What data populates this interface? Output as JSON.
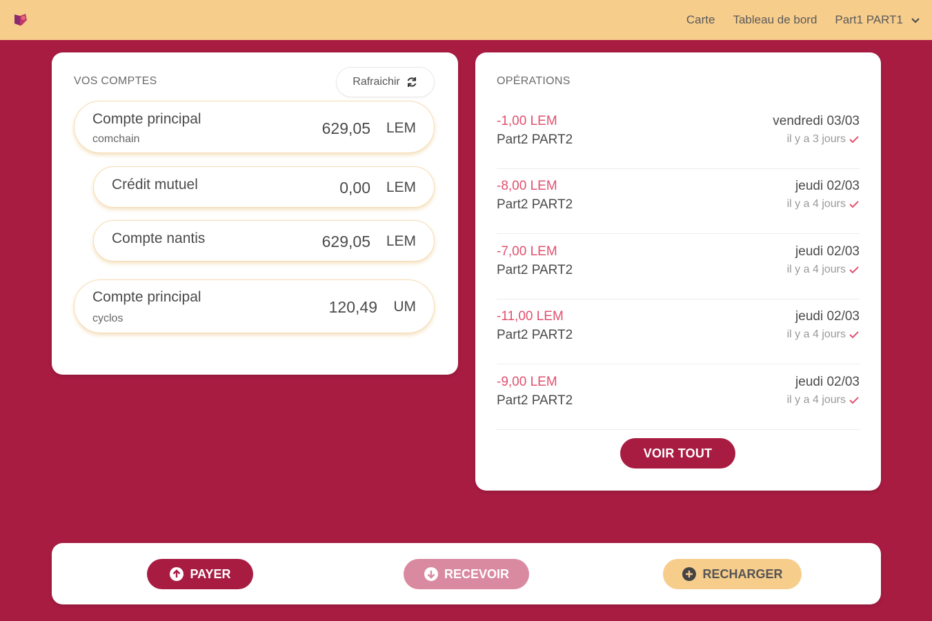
{
  "colors": {
    "background": "#a81c42",
    "topbar": "#f7cd8c",
    "negative_amount": "#e0506e",
    "pay_button": "#a81c42",
    "receive_button": "#d98aa0",
    "recharge_button": "#f7cd8c"
  },
  "topbar": {
    "logo_icon": "app-logo-icon",
    "nav": {
      "map": "Carte",
      "dashboard": "Tableau de bord",
      "user": "Part1 PART1"
    }
  },
  "accounts": {
    "title": "VOS COMPTES",
    "refresh_label": "Rafraichir",
    "items": [
      {
        "name": "Compte principal",
        "sub": "comchain",
        "amount": "629,05",
        "currency": "LEM"
      },
      {
        "name": "Crédit mutuel",
        "sub": "",
        "amount": "0,00",
        "currency": "LEM"
      },
      {
        "name": "Compte nantis",
        "sub": "",
        "amount": "629,05",
        "currency": "LEM"
      },
      {
        "name": "Compte principal",
        "sub": "cyclos",
        "amount": "120,49",
        "currency": "UM"
      }
    ]
  },
  "operations": {
    "title": "OPÉRATIONS",
    "items": [
      {
        "amount": "-1,00 LEM",
        "who": "Part2 PART2",
        "date": "vendredi 03/03",
        "ago": "il y a 3 jours"
      },
      {
        "amount": "-8,00 LEM",
        "who": "Part2 PART2",
        "date": "jeudi 02/03",
        "ago": "il y a 4 jours"
      },
      {
        "amount": "-7,00 LEM",
        "who": "Part2 PART2",
        "date": "jeudi 02/03",
        "ago": "il y a 4 jours"
      },
      {
        "amount": "-11,00 LEM",
        "who": "Part2 PART2",
        "date": "jeudi 02/03",
        "ago": "il y a 4 jours"
      },
      {
        "amount": "-9,00 LEM",
        "who": "Part2 PART2",
        "date": "jeudi 02/03",
        "ago": "il y a 4 jours"
      }
    ],
    "see_all_label": "VOIR TOUT"
  },
  "actions": {
    "pay": "PAYER",
    "receive": "RECEVOIR",
    "recharge": "RECHARGER"
  }
}
